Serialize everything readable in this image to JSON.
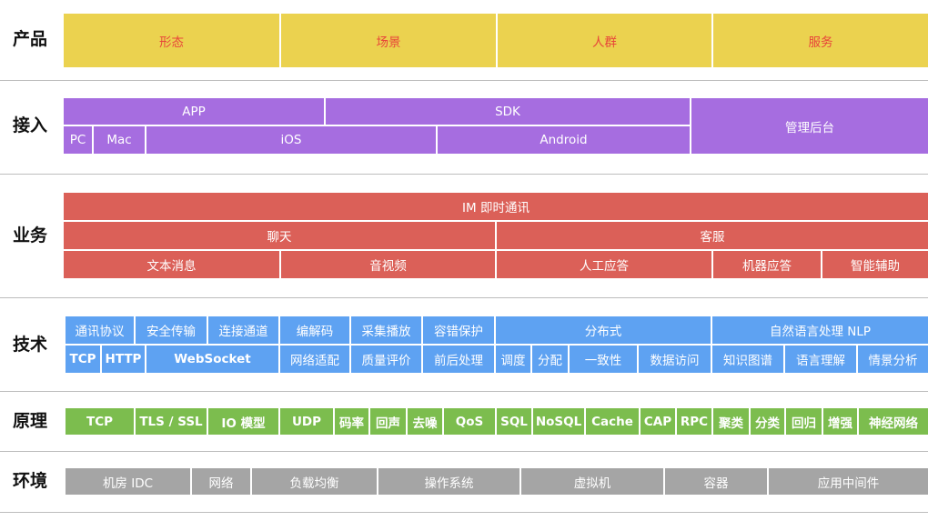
{
  "rows": {
    "product": "产品",
    "access": "接入",
    "business": "业务",
    "tech": "技术",
    "principle": "原理",
    "env": "环境"
  },
  "product": [
    "形态",
    "场景",
    "人群",
    "服务"
  ],
  "access": {
    "app": "APP",
    "sdk": "SDK",
    "admin": "管理后台",
    "pc": "PC",
    "mac": "Mac",
    "ios": "iOS",
    "android": "Android"
  },
  "business": {
    "im": "IM 即时通讯",
    "chat": "聊天",
    "service": "客服",
    "text_msg": "文本消息",
    "av": "音视频",
    "human": "人工应答",
    "bot": "机器应答",
    "assist": "智能辅助"
  },
  "tech": {
    "protocol": "通讯协议",
    "secure": "安全传输",
    "conn": "连接通道",
    "codec": "编解码",
    "capture": "采集播放",
    "fault": "容错保护",
    "distributed": "分布式",
    "nlp": "自然语言处理 NLP",
    "tcp": "TCP",
    "http": "HTTP",
    "websocket": "WebSocket",
    "adapt": "网络适配",
    "quality": "质量评价",
    "prepost": "前后处理",
    "schedule": "调度",
    "alloc": "分配",
    "consistency": "一致性",
    "data_access": "数据访问",
    "kg": "知识图谱",
    "nlu": "语言理解",
    "sentiment": "情景分析"
  },
  "principle": [
    "TCP",
    "TLS / SSL",
    "IO 模型",
    "UDP",
    "码率",
    "回声",
    "去噪",
    "QoS",
    "SQL",
    "NoSQL",
    "Cache",
    "CAP",
    "RPC",
    "聚类",
    "分类",
    "回归",
    "增强",
    "神经网络"
  ],
  "env": [
    "机房 IDC",
    "网络",
    "负载均衡",
    "操作系统",
    "虚拟机",
    "容器",
    "应用中间件"
  ],
  "colors": {
    "product": "#ebd24f",
    "product_text": "#e8463a",
    "access": "#a66de0",
    "business": "#db6058",
    "tech": "#5ea2f2",
    "principle": "#7cbd4e",
    "env": "#a5a5a5"
  }
}
